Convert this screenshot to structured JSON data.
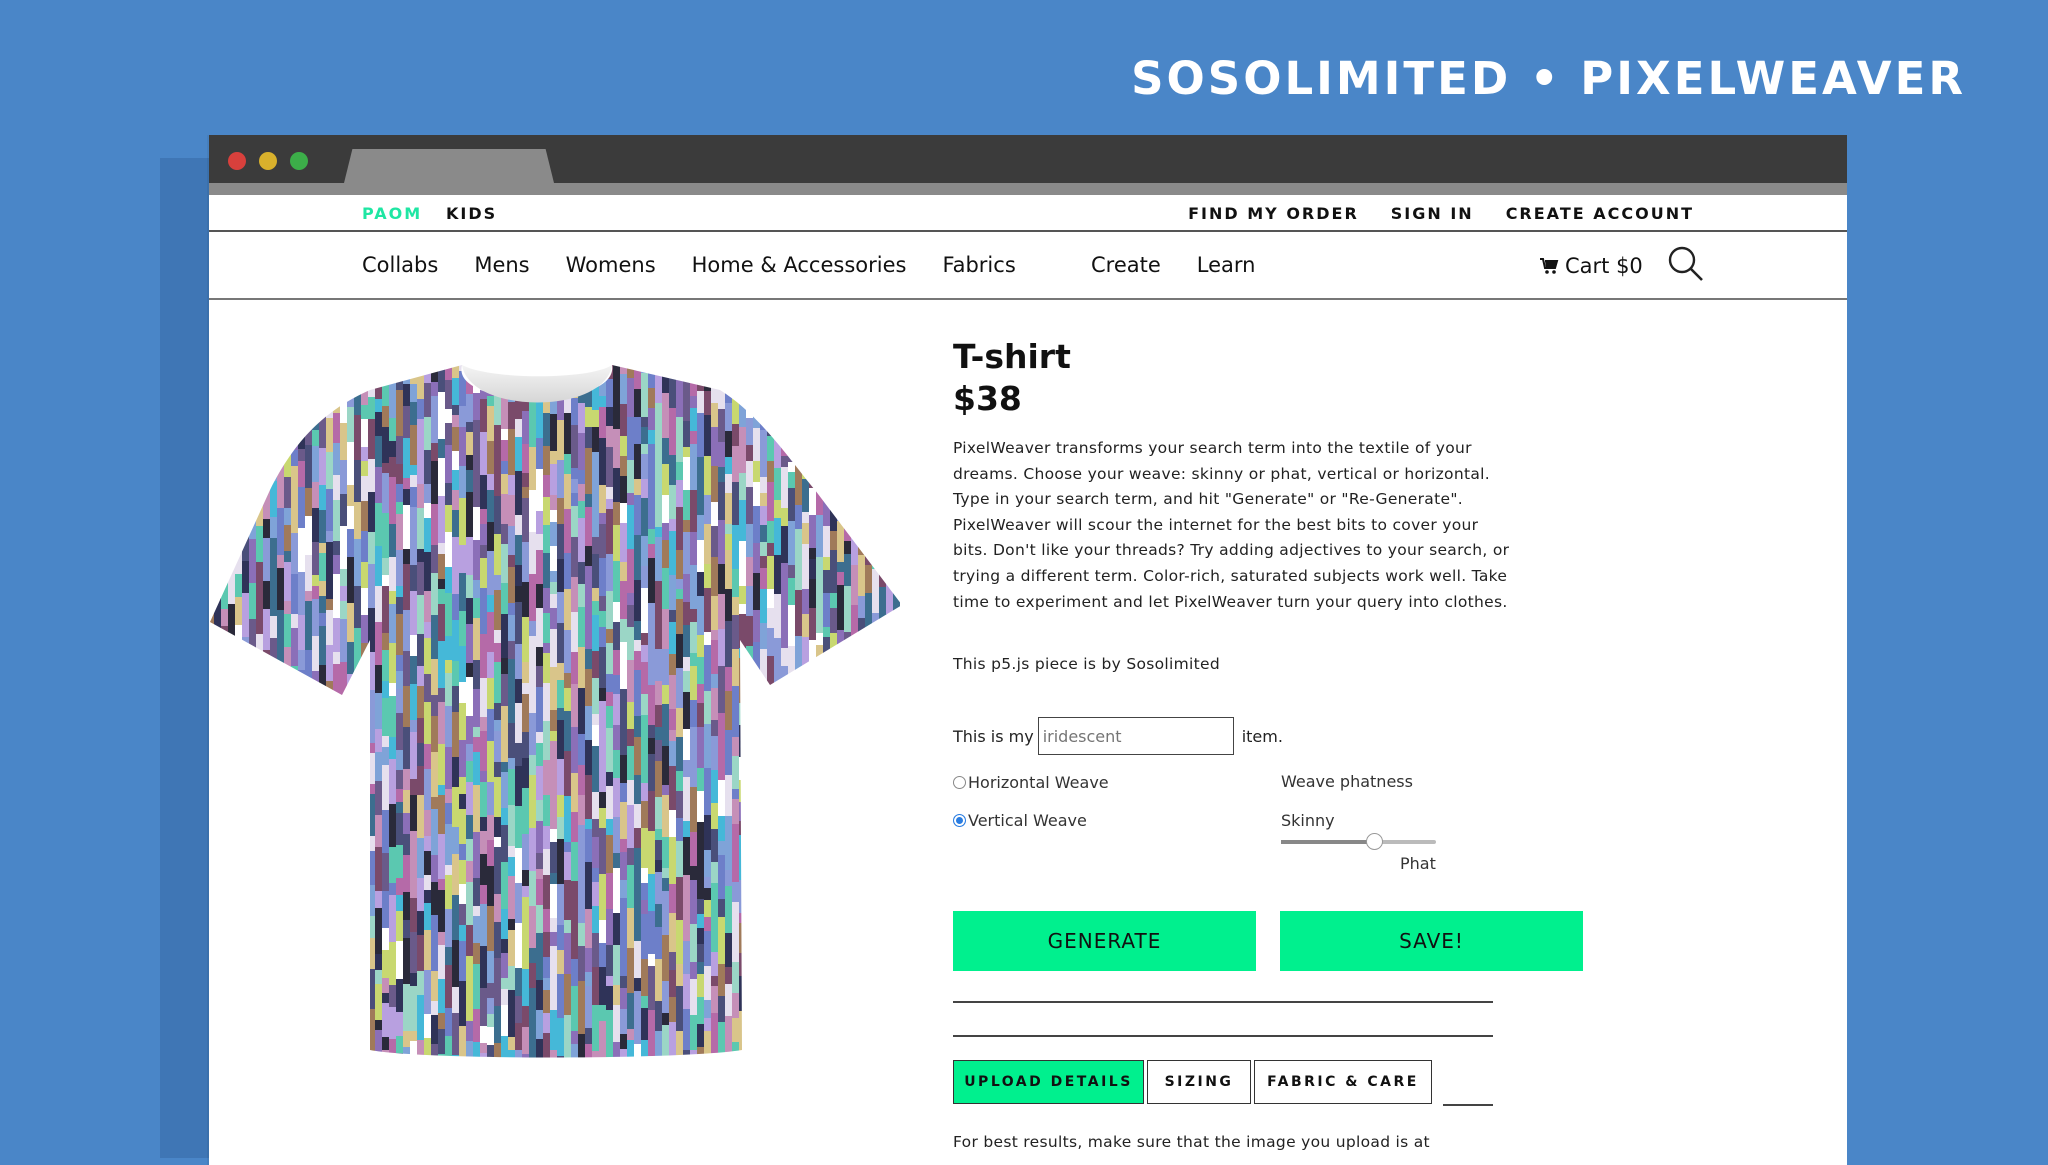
{
  "banner": "SOSOLIMITED • PIXELWEAVER",
  "topbar": {
    "brand": "PAOM",
    "kids": "KIDS",
    "links": [
      "FIND MY ORDER",
      "SIGN IN",
      "CREATE ACCOUNT"
    ]
  },
  "nav": {
    "links": [
      "Collabs",
      "Mens",
      "Womens",
      "Home & Accessories",
      "Fabrics"
    ],
    "links2": [
      "Create",
      "Learn"
    ],
    "cart": "Cart $0"
  },
  "product": {
    "title": "T-shirt",
    "price": "$38",
    "description": "PixelWeaver transforms your search term into the textile of your dreams. Choose your weave: skinny or phat, vertical or horizontal. Type in your search term, and hit \"Generate\" or \"Re-Generate\". PixelWeaver will scour the internet for the best bits to cover your bits. Don't like your threads? Try adding adjectives to your search, or trying a different term. Color-rich, saturated subjects work well. Take time to experiment and let PixelWeaver turn your query into clothes.",
    "credit": "This p5.js piece is by Sosolimited"
  },
  "form": {
    "prefix": "This is my",
    "term_value": "",
    "term_placeholder": "iridescent",
    "suffix": "item.",
    "horizontal": "Horizontal Weave",
    "vertical": "Vertical Weave",
    "selected_weave": "vertical",
    "phatness_label": "Weave phatness",
    "skinny": "Skinny",
    "phat": "Phat",
    "phatness_value": 0.6
  },
  "buttons": {
    "generate": "GENERATE",
    "save": "SAVE!"
  },
  "tabs": [
    "UPLOAD DETAILS",
    "SIZING",
    "FABRIC & CARE"
  ],
  "active_tab": "UPLOAD DETAILS",
  "footer_text": "For best results, make sure that the image you upload is at",
  "colors": {
    "background": "#4a86c8",
    "accent": "#00f08e",
    "brand": "#1fe6a3"
  }
}
